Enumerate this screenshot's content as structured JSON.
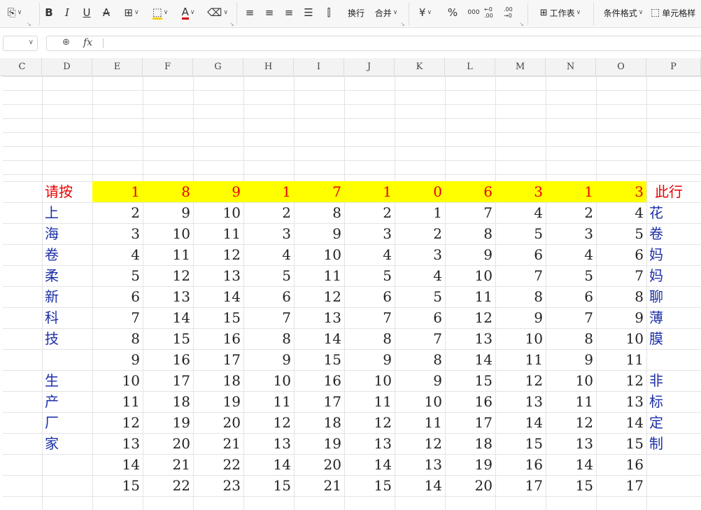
{
  "toolbar": {
    "wrap_label": "换行",
    "merge_label": "合并",
    "currency_label": "¥",
    "percent_label": "%",
    "thousands_label": "000",
    "dec_inc_label": "←0 .00",
    "dec_dec_label": ".00 →0",
    "worksheet_label": "工作表",
    "cond_format_label": "条件格式",
    "cell_style_label": "单元格样"
  },
  "formula_bar": {
    "name_box": "",
    "fx_label": "fx",
    "content": ""
  },
  "columns": [
    "C",
    "D",
    "E",
    "F",
    "G",
    "H",
    "I",
    "J",
    "K",
    "L",
    "M",
    "N",
    "O",
    "P"
  ],
  "colors": {
    "highlight_row": "#ffff00",
    "red_text": "#e60000",
    "blue_text": "#1c2fa8"
  },
  "sheet": {
    "header_left": "请按",
    "header_right": "此行",
    "header_values": [
      1,
      8,
      9,
      1,
      7,
      1,
      0,
      6,
      3,
      1,
      3
    ],
    "left_labels": [
      "上",
      "海",
      "卷",
      "柔",
      "新",
      "科",
      "技",
      "",
      "生",
      "产",
      "厂",
      "家",
      "",
      ""
    ],
    "right_labels": [
      "花",
      "卷",
      "妈",
      "妈",
      "聊",
      "薄",
      "膜",
      "",
      "非",
      "标",
      "定",
      "制",
      "",
      ""
    ],
    "rows": [
      [
        2,
        9,
        10,
        2,
        8,
        2,
        1,
        7,
        4,
        2,
        4
      ],
      [
        3,
        10,
        11,
        3,
        9,
        3,
        2,
        8,
        5,
        3,
        5
      ],
      [
        4,
        11,
        12,
        4,
        10,
        4,
        3,
        9,
        6,
        4,
        6
      ],
      [
        5,
        12,
        13,
        5,
        11,
        5,
        4,
        10,
        7,
        5,
        7
      ],
      [
        6,
        13,
        14,
        6,
        12,
        6,
        5,
        11,
        8,
        6,
        8
      ],
      [
        7,
        14,
        15,
        7,
        13,
        7,
        6,
        12,
        9,
        7,
        9
      ],
      [
        8,
        15,
        16,
        8,
        14,
        8,
        7,
        13,
        10,
        8,
        10
      ],
      [
        9,
        16,
        17,
        9,
        15,
        9,
        8,
        14,
        11,
        9,
        11
      ],
      [
        10,
        17,
        18,
        10,
        16,
        10,
        9,
        15,
        12,
        10,
        12
      ],
      [
        11,
        18,
        19,
        11,
        17,
        11,
        10,
        16,
        13,
        11,
        13
      ],
      [
        12,
        19,
        20,
        12,
        18,
        12,
        11,
        17,
        14,
        12,
        14
      ],
      [
        13,
        20,
        21,
        13,
        19,
        13,
        12,
        18,
        15,
        13,
        15
      ],
      [
        14,
        21,
        22,
        14,
        20,
        14,
        13,
        19,
        16,
        14,
        16
      ],
      [
        15,
        22,
        23,
        15,
        21,
        15,
        14,
        20,
        17,
        15,
        17
      ]
    ]
  }
}
